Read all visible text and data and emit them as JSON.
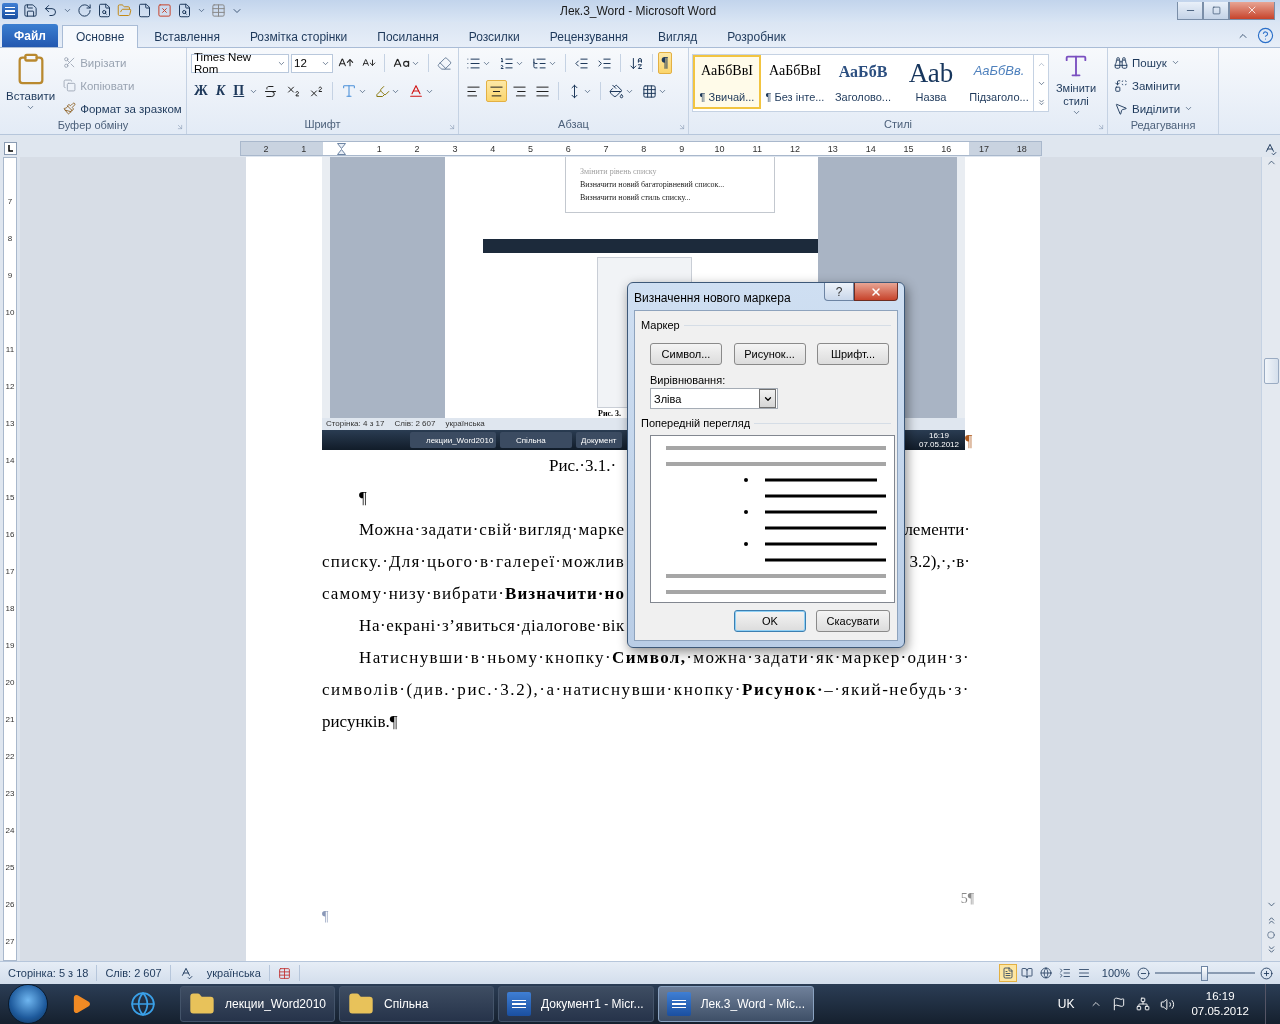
{
  "window": {
    "title": "Лек.3_Word - Microsoft Word"
  },
  "tabs": [
    {
      "label": "Файл",
      "kind": "file",
      "selected": false
    },
    {
      "label": "Основне",
      "kind": "tab",
      "selected": true
    },
    {
      "label": "Вставлення",
      "kind": "tab",
      "selected": false
    },
    {
      "label": "Розмітка сторінки",
      "kind": "tab",
      "selected": false
    },
    {
      "label": "Посилання",
      "kind": "tab",
      "selected": false
    },
    {
      "label": "Розсилки",
      "kind": "tab",
      "selected": false
    },
    {
      "label": "Рецензування",
      "kind": "tab",
      "selected": false
    },
    {
      "label": "Вигляд",
      "kind": "tab",
      "selected": false
    },
    {
      "label": "Розробник",
      "kind": "tab",
      "selected": false
    }
  ],
  "clipboard": {
    "paste": "Вставити",
    "label": "Буфер обміну",
    "items": [
      {
        "label": "Вирізати",
        "kind": "cut",
        "disabled": true
      },
      {
        "label": "Копіювати",
        "kind": "copy",
        "disabled": true
      },
      {
        "label": "Формат за зразком",
        "kind": "painter",
        "disabled": false
      }
    ]
  },
  "font": {
    "family": "Times New Rom",
    "size": "12",
    "label": "Шрифт",
    "format_buttons": [
      {
        "label": "Ж",
        "kind": "bold"
      },
      {
        "label": "К",
        "kind": "italic"
      },
      {
        "label": "П",
        "kind": "underline"
      }
    ]
  },
  "paragraph": {
    "label": "Абзац",
    "show_marks": {
      "label": "¶",
      "on": true
    },
    "align": [
      {
        "kind": "left",
        "selected": false
      },
      {
        "kind": "center",
        "selected": true
      },
      {
        "kind": "right",
        "selected": false
      },
      {
        "kind": "justify",
        "selected": false
      }
    ]
  },
  "styles": {
    "label": "Стилі",
    "change": "Змінити стилі",
    "items": [
      {
        "sample": "АаБбВвІ",
        "name": "¶ Звичай...",
        "kind": "normal",
        "selected": true
      },
      {
        "sample": "АаБбВвІ",
        "name": "¶ Без інте...",
        "kind": "nospacing",
        "selected": false
      },
      {
        "sample": "АаБбВ",
        "name": "Заголово...",
        "kind": "heading",
        "selected": false
      },
      {
        "sample": "Ааb",
        "name": "Назва",
        "kind": "title",
        "selected": false
      },
      {
        "sample": "АаБбВв.",
        "name": "Підзаголо...",
        "kind": "subtitle",
        "selected": false
      }
    ]
  },
  "editing": {
    "label": "Редагування",
    "items": [
      {
        "label": "Пошук",
        "kind": "find"
      },
      {
        "label": "Замінити",
        "kind": "replace"
      },
      {
        "label": "Виділити",
        "kind": "select"
      }
    ]
  },
  "ruler": {
    "left_labels": [
      "2",
      "1"
    ],
    "labels": [
      "1",
      "2",
      "3",
      "4",
      "5",
      "6",
      "7",
      "8",
      "9",
      "10",
      "11",
      "12",
      "13",
      "14",
      "15",
      "16",
      "17",
      "18"
    ]
  },
  "vertical_ruler": {
    "labels": [
      "7",
      "8",
      "9",
      "10",
      "11",
      "12",
      "13",
      "14",
      "15",
      "16",
      "17",
      "18",
      "19",
      "20",
      "21",
      "22",
      "23",
      "24",
      "25",
      "26",
      "27"
    ]
  },
  "figure": {
    "menu": [
      {
        "label": "Змінити рівень списку",
        "disabled": true
      },
      {
        "label": "Визначити новий багаторівневий список...",
        "disabled": false
      },
      {
        "label": "Визначити новий стиль списку...",
        "disabled": false
      }
    ],
    "caption": "Рис. 3.",
    "status": [
      "Сторінка: 4 з 17",
      "Слів: 2 607",
      "українська"
    ],
    "taskbar": [
      "лекции_Word2010",
      "Спільна",
      "Документ"
    ],
    "clock": [
      "16:19",
      "07.05.2012"
    ]
  },
  "figure_end_mark": "¶",
  "document": {
    "lines": [
      {
        "kind": "caption",
        "left": "Рис.·3.1.·"
      },
      {
        "kind": "mark",
        "left": "¶"
      },
      {
        "kind": "split",
        "indent": true,
        "left": "Можна·задати·свій·вигляд·марке",
        "right": "лементи·"
      },
      {
        "kind": "split",
        "indent": false,
        "left": "списку.·Для·цього·в·галереї·можлив",
        "right": "3.2),·,·в·"
      },
      {
        "kind": "split",
        "indent": false,
        "left": "самому·низу·вибрати·**Визначити·но**"
      },
      {
        "kind": "split",
        "indent": true,
        "left": "На·екрані·з’явиться·діалогове·вік"
      },
      {
        "kind": "full",
        "indent": true,
        "left": "Натиснувши·в·ньому·кнопку·**Символ,**·можна·задати·як·маркер·один·з·"
      },
      {
        "kind": "full",
        "indent": false,
        "left": "символів·(див.·рис.·3.2),·а·натиснувши·кнопку·**Рисунок·**–·який-небудь·з·"
      },
      {
        "kind": "last",
        "left": "рисунків.¶"
      }
    ],
    "page_number": "5¶",
    "footer_mark": "¶"
  },
  "dialog": {
    "title": "Визначення нового маркера",
    "help": "?",
    "section_marker": "Маркер",
    "buttons": [
      "Символ...",
      "Рисунок...",
      "Шрифт..."
    ],
    "align_label": "Вирівнювання:",
    "align_value": "Зліва",
    "section_preview": "Попередній перегляд",
    "ok": "OK",
    "cancel": "Скасувати"
  },
  "status_bar": {
    "page": "Сторінка: 5 з 18",
    "words": "Слів: 2 607",
    "language": "українська",
    "views": [
      {
        "kind": "print",
        "selected": true
      },
      {
        "kind": "read",
        "selected": false
      },
      {
        "kind": "web",
        "selected": false
      },
      {
        "kind": "outline",
        "selected": false
      },
      {
        "kind": "draft",
        "selected": false
      }
    ],
    "zoom": {
      "label": "100%",
      "level": 0.5
    }
  },
  "taskbar": {
    "items": [
      {
        "label": "лекции_Word2010",
        "kind": "folder",
        "selected": false
      },
      {
        "label": "Спільна",
        "kind": "folder",
        "selected": false
      },
      {
        "label": "Документ1 - Micr...",
        "kind": "word",
        "selected": false
      },
      {
        "label": "Лек.3_Word - Mic...",
        "kind": "word",
        "selected": true
      }
    ],
    "language": "UK",
    "time": "16:19",
    "date": "07.05.2012"
  }
}
